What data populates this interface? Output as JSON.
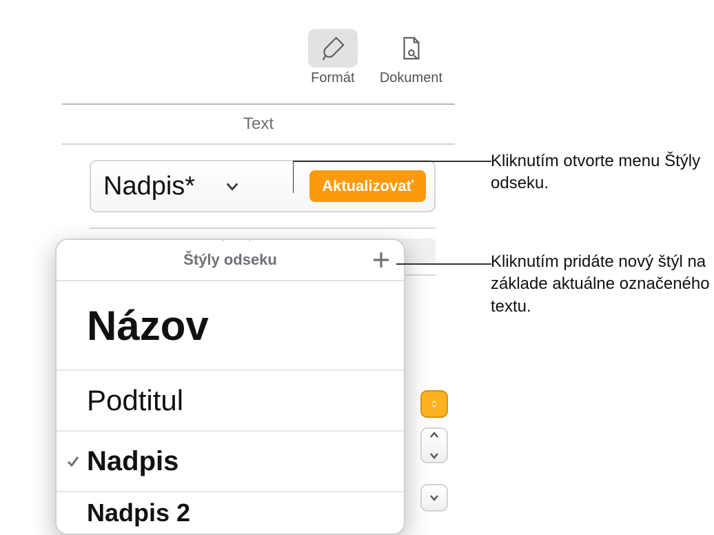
{
  "toolbar": {
    "format": "Formát",
    "document": "Dokument"
  },
  "panel": {
    "header": "Text",
    "style_name": "Nadpis*",
    "update_btn": "Aktualizovať"
  },
  "popover": {
    "title": "Štýly odseku",
    "items": {
      "title_style": "Názov",
      "subtitle_style": "Podtitul",
      "heading1": "Nadpis",
      "heading2": "Nadpis 2"
    }
  },
  "callouts": {
    "open_menu": "Kliknutím otvorte menu Štýly odseku.",
    "add_style": "Kliknutím pridáte nový štýl na základe aktuálne označeného textu."
  }
}
